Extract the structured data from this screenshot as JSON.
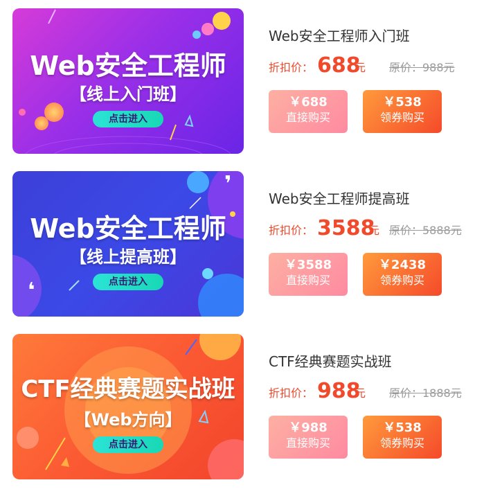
{
  "currency_symbol": "¥",
  "colors": {
    "accent": "#f1492b",
    "strike": "#9a9a9a",
    "title": "#333333"
  },
  "courses": [
    {
      "title": "Web安全工程师入门班",
      "banner": {
        "title": "Web安全工程师",
        "subtitle": "【线上入门班】",
        "button": "点击进入"
      },
      "discount_label": "折扣价：",
      "discount_price": "688",
      "unit": "元",
      "original_price": "原价：988元",
      "direct_price": "￥688",
      "direct_label": "直接购买",
      "coupon_price": "￥538",
      "coupon_label": "领券购买"
    },
    {
      "title": "Web安全工程师提高班",
      "banner": {
        "title": "Web安全工程师",
        "subtitle": "【线上提高班】",
        "button": "点击进入"
      },
      "discount_label": "折扣价：",
      "discount_price": "3588",
      "unit": "元",
      "original_price": "原价：5888元",
      "direct_price": "￥3588",
      "direct_label": "直接购买",
      "coupon_price": "￥2438",
      "coupon_label": "领券购买"
    },
    {
      "title": "CTF经典赛题实战班",
      "banner": {
        "title": "CTF经典赛题实战班",
        "subtitle": "【Web方向】",
        "button": "点击进入"
      },
      "discount_label": "折扣价：",
      "discount_price": "988",
      "unit": "元",
      "original_price": "原价：1888元",
      "direct_price": "￥988",
      "direct_label": "直接购买",
      "coupon_price": "￥538",
      "coupon_label": "领券购买"
    }
  ]
}
